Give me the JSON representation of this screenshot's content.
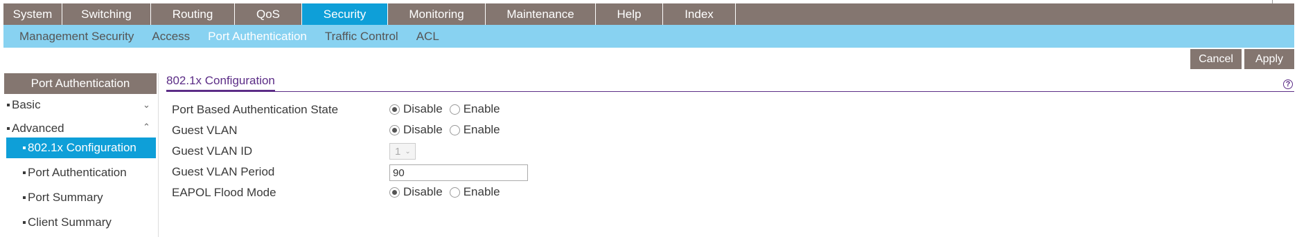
{
  "top_nav": {
    "tabs": [
      {
        "label": "System"
      },
      {
        "label": "Switching"
      },
      {
        "label": "Routing"
      },
      {
        "label": "QoS"
      },
      {
        "label": "Security"
      },
      {
        "label": "Monitoring"
      },
      {
        "label": "Maintenance"
      },
      {
        "label": "Help"
      },
      {
        "label": "Index"
      }
    ],
    "active": "Security"
  },
  "sub_nav": {
    "items": [
      {
        "label": "Management Security"
      },
      {
        "label": "Access"
      },
      {
        "label": "Port Authentication"
      },
      {
        "label": "Traffic Control"
      },
      {
        "label": "ACL"
      }
    ],
    "active": "Port Authentication"
  },
  "actions": {
    "cancel_label": "Cancel",
    "apply_label": "Apply"
  },
  "sidebar": {
    "header": "Port Authentication",
    "groups": [
      {
        "label": "Basic",
        "expanded": false
      },
      {
        "label": "Advanced",
        "expanded": true
      }
    ],
    "items": [
      {
        "label": "802.1x Configuration",
        "active": true
      },
      {
        "label": "Port Authentication"
      },
      {
        "label": "Port Summary"
      },
      {
        "label": "Client Summary"
      }
    ]
  },
  "content": {
    "title": "802.1x Configuration",
    "help_icon": "question-circle-icon",
    "fields": {
      "port_auth_state": {
        "label": "Port Based Authentication State",
        "options": [
          "Disable",
          "Enable"
        ],
        "selected": "Disable"
      },
      "guest_vlan": {
        "label": "Guest VLAN",
        "options": [
          "Disable",
          "Enable"
        ],
        "selected": "Disable"
      },
      "guest_vlan_id": {
        "label": "Guest VLAN ID",
        "value": "1"
      },
      "guest_vlan_period": {
        "label": "Guest VLAN Period",
        "value": "90"
      },
      "eapol_flood_mode": {
        "label": "EAPOL Flood Mode",
        "options": [
          "Disable",
          "Enable"
        ],
        "selected": "Disable"
      }
    }
  },
  "colors": {
    "nav_bg": "#847670",
    "active_blue": "#0e9fd8",
    "subnav_bg": "#88d2f1",
    "title_purple": "#5b2c86"
  }
}
